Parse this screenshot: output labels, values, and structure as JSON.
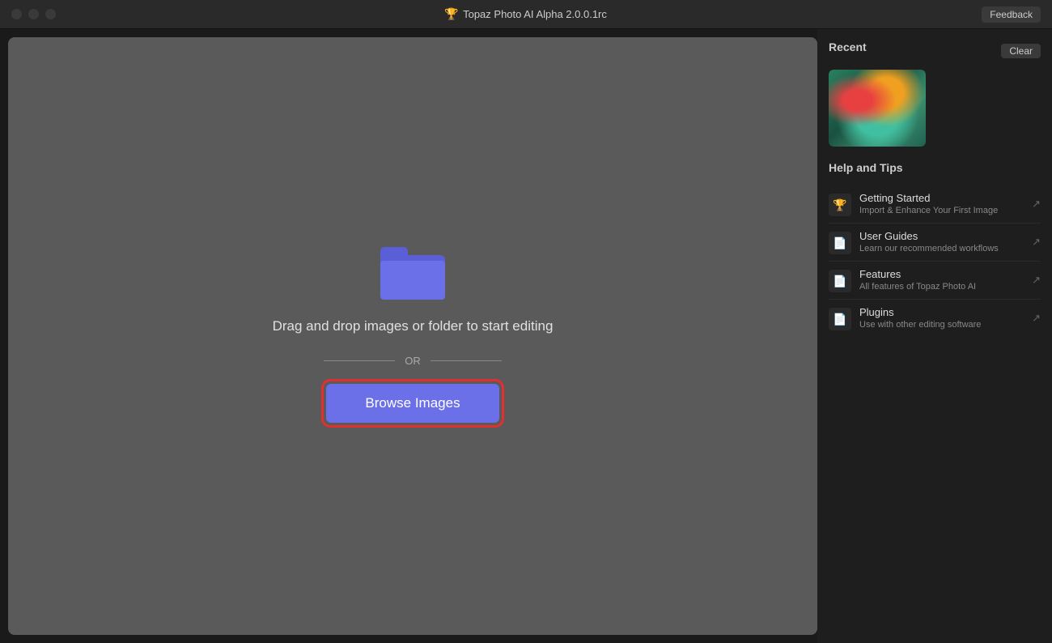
{
  "titlebar": {
    "title": "Topaz Photo AI Alpha 2.0.0.1rc",
    "feedback_label": "Feedback"
  },
  "main": {
    "drag_text": "Drag and drop images\nor folder to start\nediting",
    "or_label": "OR",
    "browse_label": "Browse Images"
  },
  "sidebar": {
    "recent_label": "Recent",
    "clear_label": "Clear",
    "help_title": "Help and Tips",
    "help_items": [
      {
        "title": "Getting Started",
        "subtitle": "Import & Enhance Your First Image",
        "icon": "trophy"
      },
      {
        "title": "User Guides",
        "subtitle": "Learn our recommended workflows",
        "icon": "doc"
      },
      {
        "title": "Features",
        "subtitle": "All features of Topaz Photo AI",
        "icon": "doc"
      },
      {
        "title": "Plugins",
        "subtitle": "Use with other editing software",
        "icon": "doc"
      }
    ]
  },
  "colors": {
    "accent": "#6b70e8",
    "highlight_border": "#e03030"
  }
}
